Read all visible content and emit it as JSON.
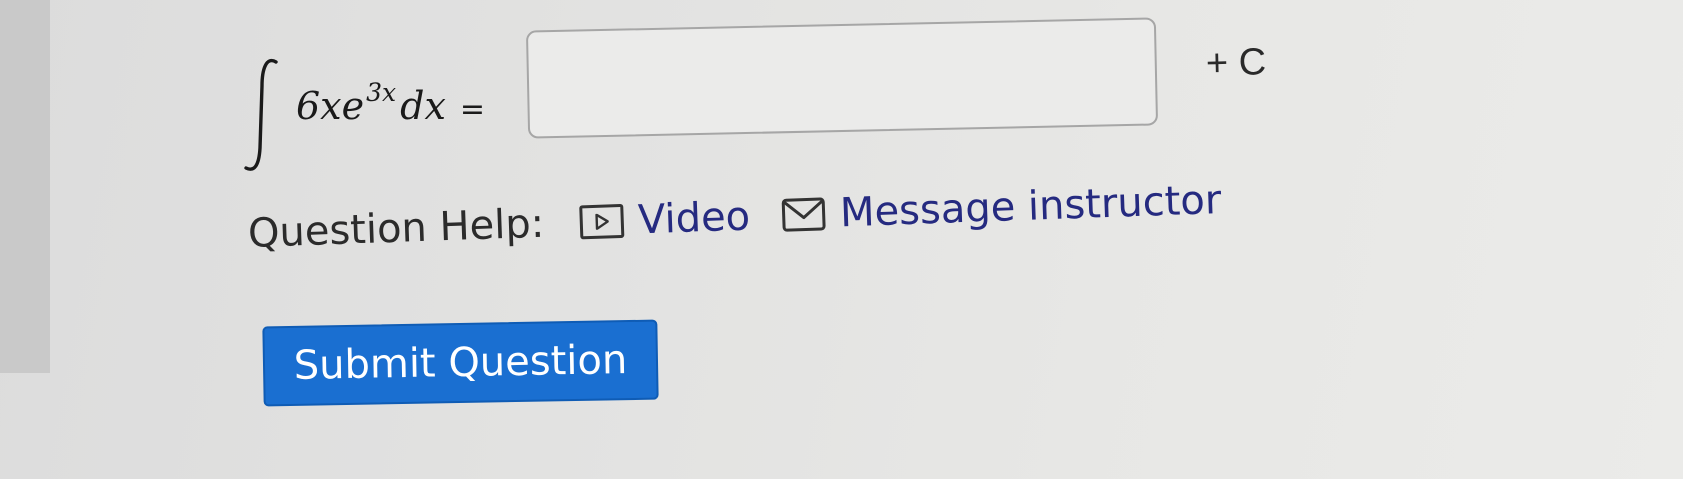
{
  "question": {
    "coefficient": "6x",
    "base": "e",
    "exponent": "3x",
    "differential": "dx",
    "equals": "=",
    "answer_value": "",
    "constant": "+ C"
  },
  "help": {
    "label": "Question Help:",
    "video_label": "Video",
    "message_label": "Message instructor"
  },
  "submit": {
    "label": "Submit Question"
  },
  "colors": {
    "accent": "#1a6fd1",
    "link": "#252a80",
    "background": "#e4e4e3"
  },
  "icons": {
    "integral": "integral-sign",
    "video": "play-box-icon",
    "message": "envelope-icon"
  }
}
